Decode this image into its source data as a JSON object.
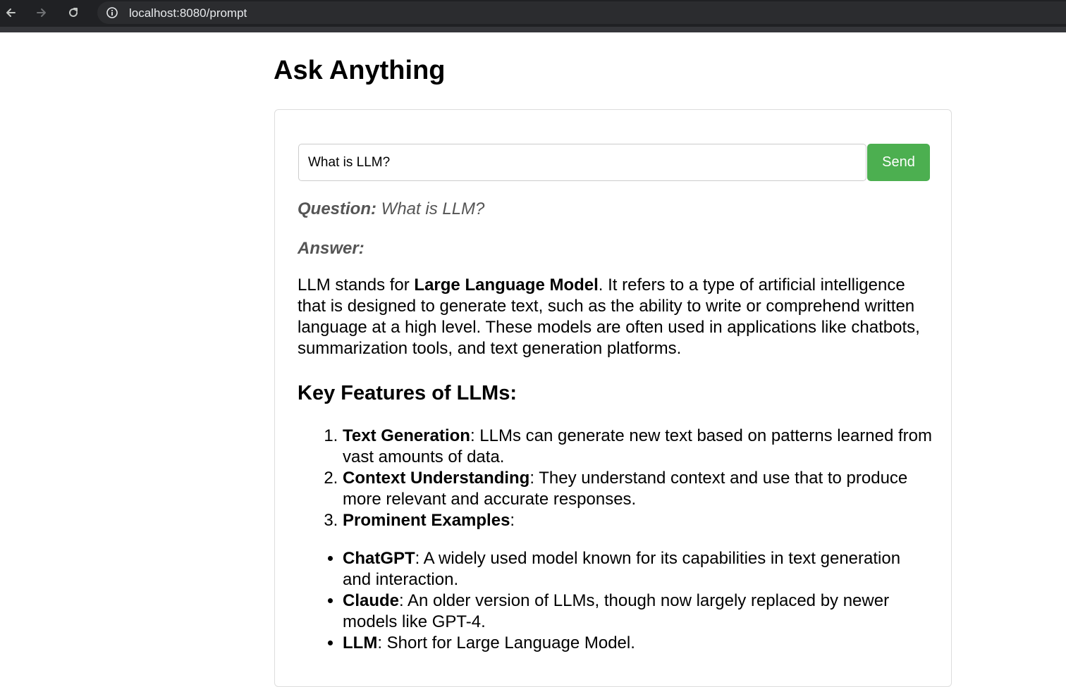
{
  "browser": {
    "back_icon": "arrow-left-icon",
    "forward_icon": "arrow-right-icon",
    "reload_icon": "reload-icon",
    "site_info_icon": "info-icon",
    "url": "localhost:8080/prompt"
  },
  "page": {
    "title": "Ask Anything"
  },
  "prompt": {
    "input_value": "What is LLM?",
    "send_label": "Send",
    "send_color": "#4caf50"
  },
  "result": {
    "question_label": "Question:",
    "question_text": "What is LLM?",
    "answer_label": "Answer:",
    "intro": {
      "before": "LLM stands for ",
      "bold": "Large Language Model",
      "after": ". It refers to a type of artificial intelligence that is designed to generate text, such as the ability to write or comprehend written language at a high level. These models are often used in applications like chatbots, summarization tools, and text generation platforms."
    },
    "features_heading": "Key Features of LLMs:",
    "features": [
      {
        "term": "Text Generation",
        "desc": ": LLMs can generate new text based on patterns learned from vast amounts of data."
      },
      {
        "term": "Context Understanding",
        "desc": ": They understand context and use that to produce more relevant and accurate responses."
      },
      {
        "term": "Prominent Examples",
        "desc": ":"
      }
    ],
    "examples": [
      {
        "term": "ChatGPT",
        "desc": ": A widely used model known for its capabilities in text generation and interaction."
      },
      {
        "term": "Claude",
        "desc": ": An older version of LLMs, though now largely replaced by newer models like GPT-4."
      },
      {
        "term": "LLM",
        "desc": ": Short for Large Language Model."
      }
    ]
  }
}
